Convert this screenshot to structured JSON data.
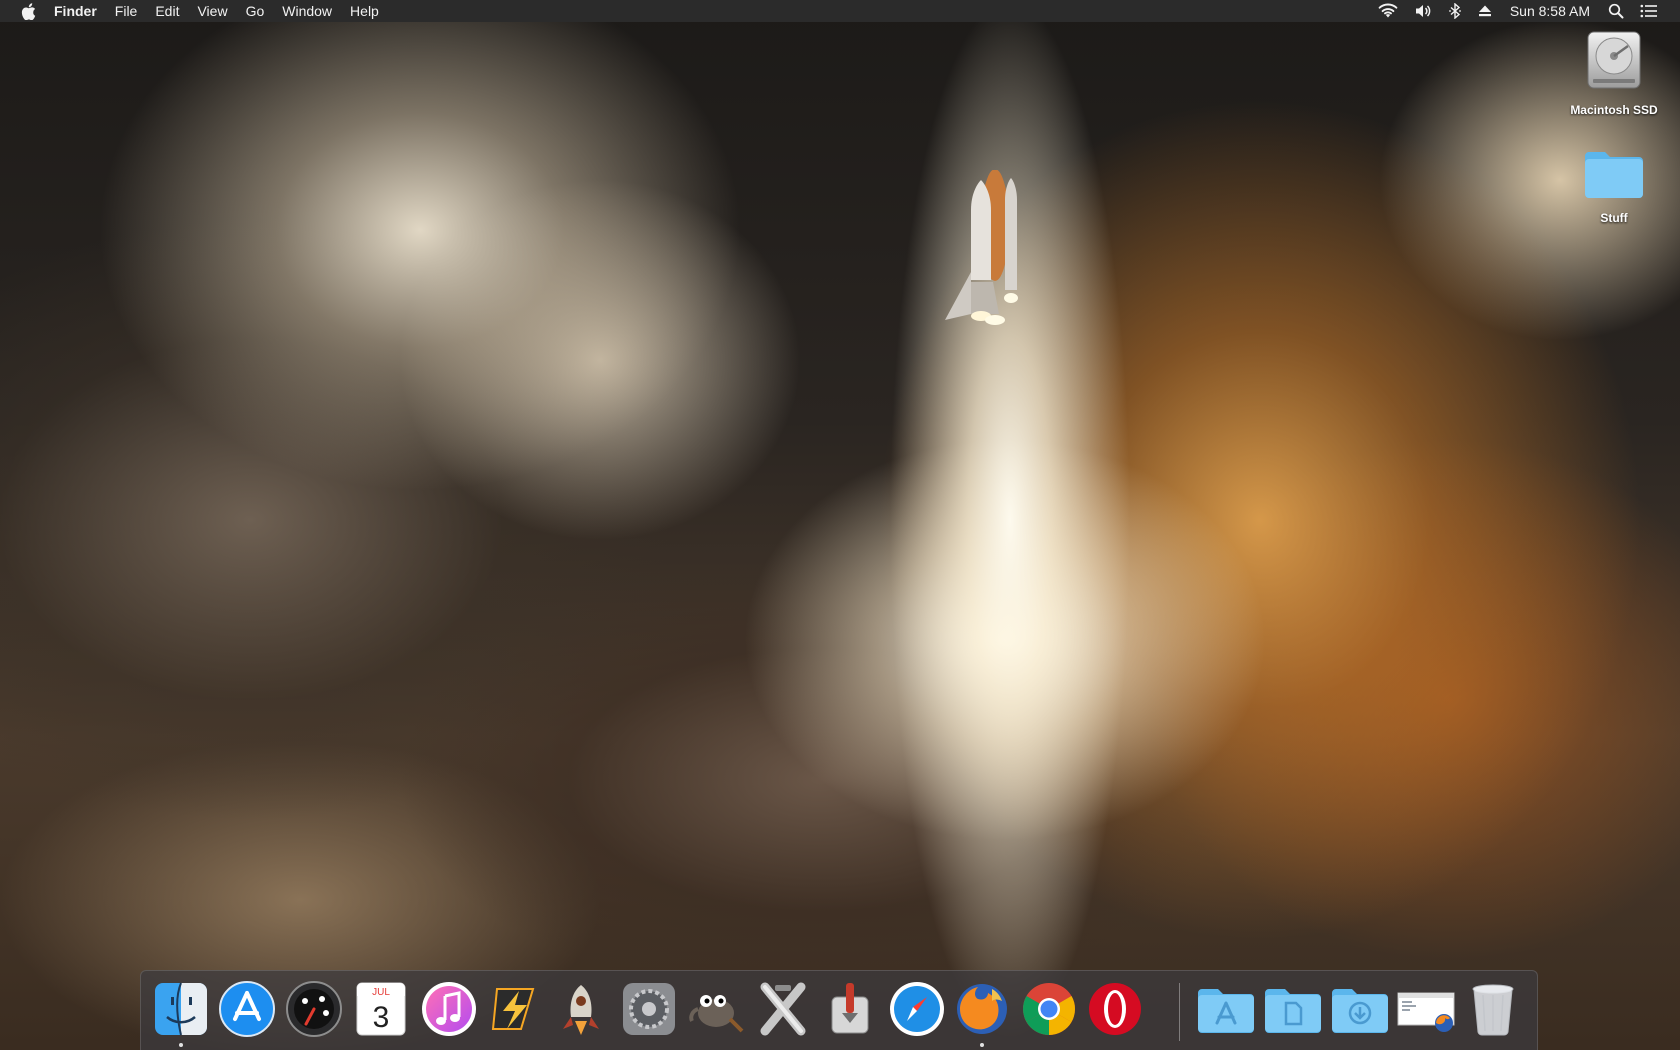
{
  "menubar": {
    "app_name": "Finder",
    "items": [
      "File",
      "Edit",
      "View",
      "Go",
      "Window",
      "Help"
    ],
    "clock": "Sun 8:58 AM",
    "status_icons": [
      "wifi-icon",
      "volume-icon",
      "bluetooth-icon",
      "eject-icon",
      "spotlight-icon",
      "notification-center-icon"
    ]
  },
  "desktop": {
    "icons": [
      {
        "label": "Macintosh SSD",
        "icon": "hard-drive-icon"
      },
      {
        "label": "Stuff",
        "icon": "folder-icon"
      }
    ]
  },
  "dock": {
    "apps": [
      {
        "icon": "finder-icon",
        "running": true
      },
      {
        "icon": "app-store-icon",
        "running": false
      },
      {
        "icon": "dashboard-icon",
        "running": false
      },
      {
        "icon": "calendar-icon",
        "running": false,
        "calendar_month": "JUL",
        "calendar_day": "3"
      },
      {
        "icon": "itunes-icon",
        "running": false
      },
      {
        "icon": "winamp-icon",
        "running": false
      },
      {
        "icon": "rocket-app-icon",
        "running": false
      },
      {
        "icon": "system-preferences-icon",
        "running": false
      },
      {
        "icon": "gimp-icon",
        "running": false
      },
      {
        "icon": "x11-icon",
        "running": false
      },
      {
        "icon": "transmission-icon",
        "running": false
      },
      {
        "icon": "safari-icon",
        "running": false
      },
      {
        "icon": "firefox-icon",
        "running": true
      },
      {
        "icon": "chrome-icon",
        "running": false
      },
      {
        "icon": "opera-icon",
        "running": false
      }
    ],
    "stacks": [
      {
        "icon": "applications-folder-icon"
      },
      {
        "icon": "documents-folder-icon"
      },
      {
        "icon": "downloads-folder-icon"
      },
      {
        "icon": "minimized-firefox-window-icon"
      },
      {
        "icon": "trash-icon"
      }
    ]
  },
  "colors": {
    "menubar_bg": "#2b2b2b",
    "folder_blue": "#6ec3f2",
    "safari_blue": "#1f8fe6",
    "chrome_red": "#db4437",
    "chrome_green": "#0f9d58",
    "chrome_yellow": "#f4b400"
  }
}
